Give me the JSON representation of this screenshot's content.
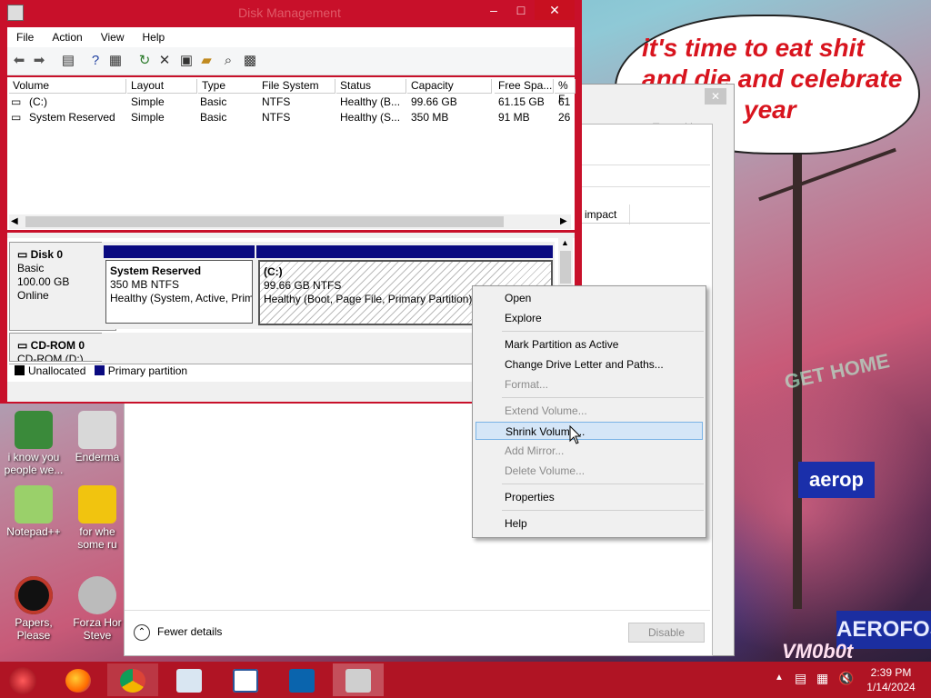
{
  "wallpaper": {
    "bubble_line1": "it's time to eat shit",
    "bubble_line2": "and die and celebrate",
    "bubble_line3": "year",
    "sign_gethome": "GET HOME",
    "sign_aerofos": "AEROFOS",
    "sign_aero": "aerop",
    "watermark": "VM0b0t"
  },
  "desktop_icons": [
    {
      "label": "i know you people we..."
    },
    {
      "label": "Enderma"
    },
    {
      "label": "Notepad++"
    },
    {
      "label": "for whe some ru"
    },
    {
      "label": "Papers, Please"
    },
    {
      "label": "Forza Hor Steve"
    }
  ],
  "disk_mgmt": {
    "title": "Disk Management",
    "menu": [
      "File",
      "Action",
      "View",
      "Help"
    ],
    "columns": [
      "Volume",
      "Layout",
      "Type",
      "File System",
      "Status",
      "Capacity",
      "Free Spa...",
      "% F"
    ],
    "rows": [
      [
        "(C:)",
        "Simple",
        "Basic",
        "NTFS",
        "Healthy (B...",
        "99.66 GB",
        "61.15 GB",
        "61"
      ],
      [
        "System Reserved",
        "Simple",
        "Basic",
        "NTFS",
        "Healthy (S...",
        "350 MB",
        "91 MB",
        "26"
      ]
    ],
    "disk0": {
      "name": "Disk 0",
      "type": "Basic",
      "size": "100.00 GB",
      "state": "Online",
      "part1_name": "System Reserved",
      "part1_size": "350 MB NTFS",
      "part1_status": "Healthy (System, Active, Prim",
      "part2_name": "(C:)",
      "part2_size": "99.66 GB NTFS",
      "part2_status": "Healthy (Boot, Page File, Primary Partition)"
    },
    "cdrom": {
      "name": "CD-ROM 0",
      "drive": "CD-ROM (D:)"
    },
    "legend": [
      "Unallocated",
      "Primary partition"
    ],
    "colors": {
      "unallocated": "#000000",
      "primary": "#0a0a80"
    }
  },
  "task_manager": {
    "tab_partial": "p impact",
    "fewer_details": "Fewer details",
    "disable": "Disable"
  },
  "context_menu": {
    "items": [
      {
        "label": "Open",
        "enabled": true
      },
      {
        "label": "Explore",
        "enabled": true
      },
      {
        "label": "Mark Partition as Active",
        "enabled": true
      },
      {
        "label": "Change Drive Letter and Paths...",
        "enabled": true
      },
      {
        "label": "Format...",
        "enabled": false
      },
      {
        "label": "Extend Volume...",
        "enabled": false
      },
      {
        "label": "Shrink Volume...",
        "enabled": true,
        "highlighted": true
      },
      {
        "label": "Add Mirror...",
        "enabled": false
      },
      {
        "label": "Delete Volume...",
        "enabled": false
      },
      {
        "label": "Properties",
        "enabled": true
      },
      {
        "label": "Help",
        "enabled": true
      }
    ]
  },
  "taskbar": {
    "time": "2:39 PM",
    "date": "1/14/2024",
    "apps": [
      "firefox-icon",
      "chrome-icon",
      "task-manager-icon",
      "word-icon",
      "outlook-icon",
      "disk-management-icon"
    ]
  }
}
